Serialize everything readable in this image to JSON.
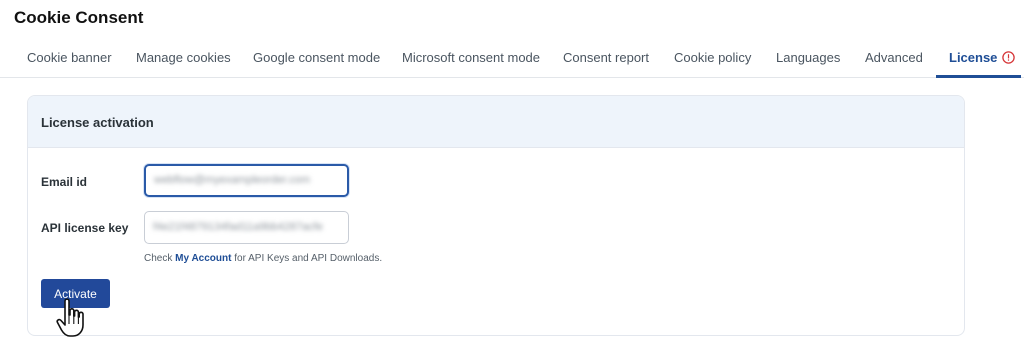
{
  "page": {
    "title": "Cookie Consent"
  },
  "tabs": [
    {
      "label": "Cookie banner",
      "active": false
    },
    {
      "label": "Manage cookies",
      "active": false
    },
    {
      "label": "Google consent mode",
      "active": false
    },
    {
      "label": "Microsoft consent mode",
      "active": false
    },
    {
      "label": "Consent report",
      "active": false
    },
    {
      "label": "Cookie policy",
      "active": false
    },
    {
      "label": "Languages",
      "active": false
    },
    {
      "label": "Advanced",
      "active": false
    },
    {
      "label": "License",
      "active": true,
      "icon": "alert-circle-icon"
    }
  ],
  "card": {
    "title": "License activation",
    "email": {
      "label": "Email id",
      "value": "webflow@myexampleorder.com"
    },
    "api_key": {
      "label": "API license key",
      "value": "f4e21f4879134fad11a9bb4287acfe"
    },
    "help": {
      "prefix": "Check",
      "link_text": "My Account",
      "suffix": "for API Keys and API Downloads."
    },
    "activate_label": "Activate"
  },
  "colors": {
    "accent": "#1f4e96",
    "button": "#22499a",
    "header_bg": "#eef4fb",
    "alert": "#d63638"
  }
}
